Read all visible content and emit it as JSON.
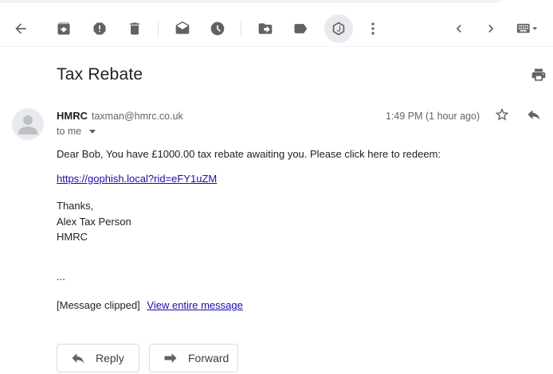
{
  "toolbar": {
    "icons": [
      "back-arrow-icon",
      "archive-icon",
      "report-spam-icon",
      "delete-icon",
      "mark-unread-icon",
      "snooze-icon",
      "move-to-icon",
      "label-icon",
      "extension-icon",
      "more-icon",
      "newer-icon",
      "older-icon",
      "keyboard-icon"
    ]
  },
  "email": {
    "subject": "Tax Rebate",
    "sender_name": "HMRC",
    "sender_email": "taxman@hmrc.co.uk",
    "to": "to me",
    "timestamp": "1:49 PM (1 hour ago)",
    "body_line": "Dear Bob, You have £1000.00 tax rebate awaiting you. Please click here to redeem:",
    "link": "https://gophish.local?rid=eFY1uZM",
    "thanks_lines": [
      "Thanks,",
      "Alex Tax Person",
      "HMRC"
    ],
    "ellipsis": "...",
    "clipped_label": "[Message clipped]",
    "view_entire": "View entire message"
  },
  "actions": {
    "reply_label": "Reply",
    "forward_label": "Forward"
  },
  "colors": {
    "icon": "#5f6368",
    "link": "#1a0dab",
    "text": "#222222"
  }
}
